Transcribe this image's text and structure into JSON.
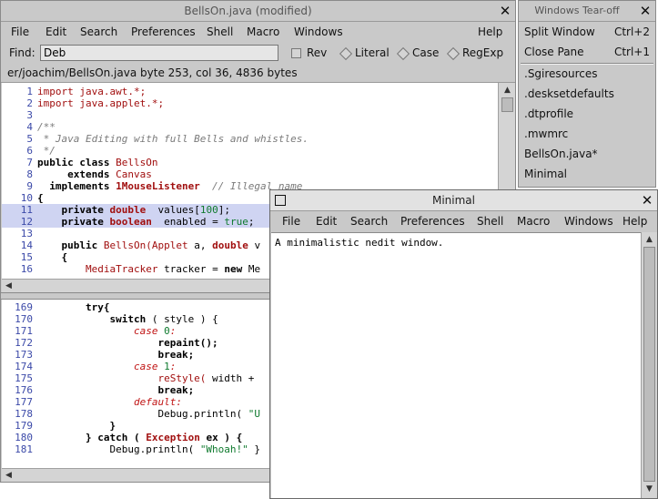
{
  "editor": {
    "title": "BellsOn.java (modified)",
    "close_glyph": "✕",
    "menus": [
      "File",
      "Edit",
      "Search",
      "Preferences",
      "Shell",
      "Macro",
      "Windows",
      "Help"
    ],
    "find": {
      "label": "Find:",
      "value": "Deb",
      "options": {
        "rev": "Rev",
        "literal": "Literal",
        "case": "Case",
        "regexp": "RegExp"
      }
    },
    "status": "er/joachim/BellsOn.java byte 253, col 36, 4836 bytes",
    "pane1": {
      "line_numbers": [
        "1",
        "2",
        "3",
        "4",
        "5",
        "6",
        "7",
        "8",
        "9",
        "10",
        "11",
        "12",
        "13",
        "14",
        "15",
        "16"
      ],
      "lines": [
        [
          {
            "t": "import java.awt.*;",
            "c": "cl"
          }
        ],
        [
          {
            "t": "import java.applet.*;",
            "c": "cl"
          }
        ],
        [
          {
            "t": "",
            "c": ""
          }
        ],
        [
          {
            "t": "/**",
            "c": "cm"
          }
        ],
        [
          {
            "t": " * Java Editing with full Bells and whistles.",
            "c": "cm"
          }
        ],
        [
          {
            "t": " */",
            "c": "cm"
          }
        ],
        [
          {
            "t": "public class ",
            "c": "kw"
          },
          {
            "t": "BellsOn",
            "c": "cl"
          }
        ],
        [
          {
            "t": "     extends ",
            "c": "kw"
          },
          {
            "t": "Canvas",
            "c": "cl"
          }
        ],
        [
          {
            "t": "  implements ",
            "c": "kw"
          },
          {
            "t": "1MouseListener",
            "c": "ty"
          },
          {
            "t": "  // Illegal name",
            "c": "cm"
          }
        ],
        [
          {
            "t": "{",
            "c": "kw"
          }
        ],
        [
          {
            "t": "    ",
            "c": ""
          },
          {
            "t": "private ",
            "c": "kw"
          },
          {
            "t": "double",
            "c": "ty"
          },
          {
            "t": "  values[",
            "c": ""
          },
          {
            "t": "100",
            "c": "nu"
          },
          {
            "t": "];",
            "c": ""
          }
        ],
        [
          {
            "t": "    ",
            "c": ""
          },
          {
            "t": "private ",
            "c": "kw"
          },
          {
            "t": "boolean",
            "c": "ty"
          },
          {
            "t": "  enabled = ",
            "c": ""
          },
          {
            "t": "true",
            "c": "nu"
          },
          {
            "t": ";",
            "c": ""
          }
        ],
        [
          {
            "t": "",
            "c": ""
          }
        ],
        [
          {
            "t": "    public ",
            "c": "kw"
          },
          {
            "t": "BellsOn(",
            "c": "cl"
          },
          {
            "t": "Applet",
            "c": "cl"
          },
          {
            "t": " a, ",
            "c": ""
          },
          {
            "t": "double",
            "c": "ty"
          },
          {
            "t": " v",
            "c": ""
          }
        ],
        [
          {
            "t": "    {",
            "c": "kw"
          }
        ],
        [
          {
            "t": "        ",
            "c": ""
          },
          {
            "t": "MediaTracker",
            "c": "cl"
          },
          {
            "t": " tracker = ",
            "c": ""
          },
          {
            "t": "new ",
            "c": "kw"
          },
          {
            "t": "Me",
            "c": ""
          }
        ]
      ]
    },
    "pane2": {
      "line_numbers": [
        "169",
        "170",
        "171",
        "172",
        "173",
        "174",
        "175",
        "176",
        "177",
        "178",
        "179",
        "180",
        "181"
      ],
      "lines": [
        [
          {
            "t": "        try{",
            "c": "kw"
          }
        ],
        [
          {
            "t": "            switch",
            "c": "kw"
          },
          {
            "t": " ( style ) {",
            "c": ""
          }
        ],
        [
          {
            "t": "                case ",
            "c": "lab"
          },
          {
            "t": "0",
            "c": "nu"
          },
          {
            "t": ":",
            "c": "lab"
          }
        ],
        [
          {
            "t": "                    repaint();",
            "c": "kw"
          }
        ],
        [
          {
            "t": "                    break;",
            "c": "kw"
          }
        ],
        [
          {
            "t": "                case ",
            "c": "lab"
          },
          {
            "t": "1",
            "c": "nu"
          },
          {
            "t": ":",
            "c": "lab"
          }
        ],
        [
          {
            "t": "                    reStyle(",
            "c": "cl"
          },
          {
            "t": " width +",
            "c": ""
          }
        ],
        [
          {
            "t": "                    break;",
            "c": "kw"
          }
        ],
        [
          {
            "t": "                default:",
            "c": "lab"
          }
        ],
        [
          {
            "t": "                    Debug.println( ",
            "c": ""
          },
          {
            "t": "\"U",
            "c": "st"
          }
        ],
        [
          {
            "t": "            }",
            "c": "kw"
          }
        ],
        [
          {
            "t": "        } catch ( ",
            "c": "kw"
          },
          {
            "t": "Exception",
            "c": "ty"
          },
          {
            "t": " ex ) {",
            "c": "kw"
          }
        ],
        [
          {
            "t": "            Debug.println( ",
            "c": ""
          },
          {
            "t": "\"Whoah!\"",
            "c": "st"
          },
          {
            "t": " }",
            "c": ""
          }
        ]
      ]
    }
  },
  "tearoff": {
    "title": "Windows Tear-off",
    "items": [
      {
        "label": "Split Window",
        "accel": "Ctrl+2"
      },
      {
        "label": "Close Pane",
        "accel": "Ctrl+1"
      }
    ],
    "files": [
      ".Sgiresources",
      ".desksetdefaults",
      ".dtprofile",
      ".mwmrc",
      "BellsOn.java*",
      "Minimal"
    ]
  },
  "minimal": {
    "title": "Minimal",
    "menus": [
      "File",
      "Edit",
      "Search",
      "Preferences",
      "Shell",
      "Macro",
      "Windows",
      "Help"
    ],
    "text": "A minimalistic nedit window."
  }
}
